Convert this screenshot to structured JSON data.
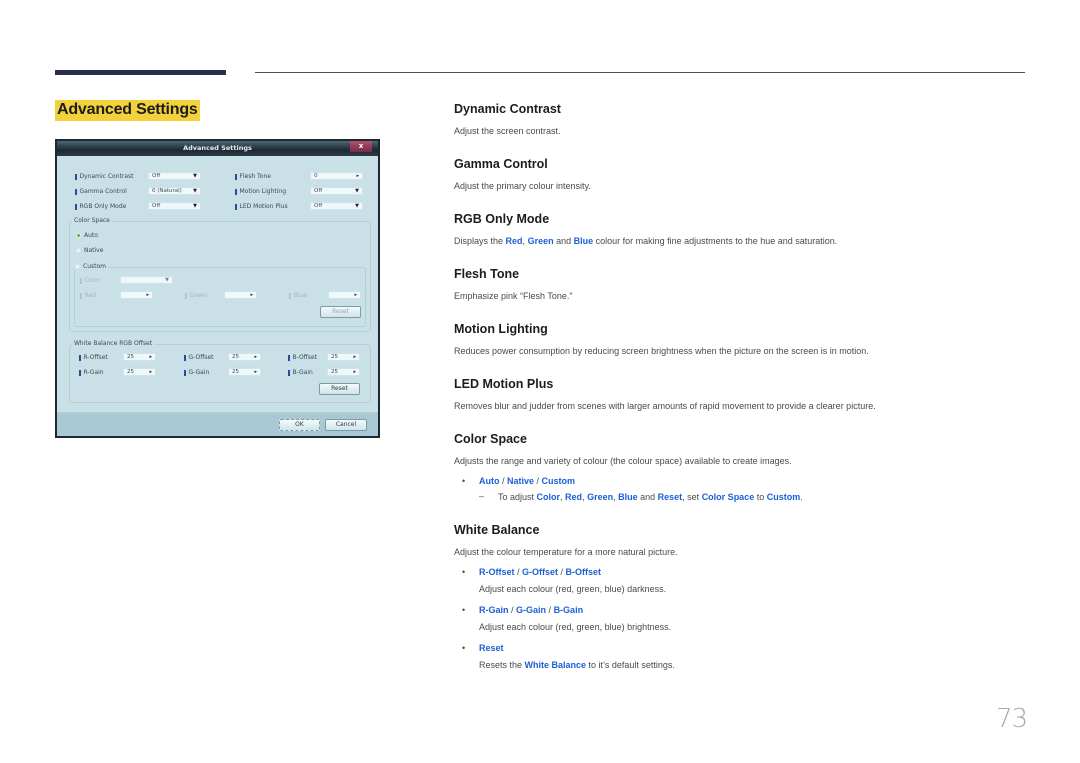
{
  "page": {
    "section_title": "Advanced Settings",
    "page_number": "73",
    "accent_color": "#1b5fd6",
    "highlight_color": "#f2d13a"
  },
  "dialog": {
    "title": "Advanced Settings",
    "close_label": "x",
    "left_settings": [
      {
        "label": "Dynamic Contrast",
        "value": "Off",
        "control": "dropdown"
      },
      {
        "label": "Gamma Control",
        "value": "0 (Natural)",
        "control": "dropdown"
      },
      {
        "label": "RGB Only Mode",
        "value": "Off",
        "control": "dropdown"
      }
    ],
    "right_settings": [
      {
        "label": "Flesh Tone",
        "value": "0",
        "control": "stepper"
      },
      {
        "label": "Motion Lighting",
        "value": "Off",
        "control": "dropdown"
      },
      {
        "label": "LED Motion Plus",
        "value": "Off",
        "control": "dropdown"
      }
    ],
    "color_space": {
      "legend": "Color Space",
      "options": [
        "Auto",
        "Native",
        "Custom"
      ],
      "selected": "Auto",
      "custom": {
        "color_label": "Color",
        "color_value": "",
        "red_label": "Red",
        "green_label": "Green",
        "blue_label": "Blue",
        "red_value": "",
        "green_value": "",
        "blue_value": "",
        "reset_label": "Reset"
      }
    },
    "white_balance": {
      "legend": "White Balance RGB Offset",
      "rows": [
        [
          {
            "label": "R-Offset",
            "value": "25"
          },
          {
            "label": "G-Offset",
            "value": "25"
          },
          {
            "label": "B-Offset",
            "value": "25"
          }
        ],
        [
          {
            "label": "R-Gain",
            "value": "25"
          },
          {
            "label": "G-Gain",
            "value": "25"
          },
          {
            "label": "B-Gain",
            "value": "25"
          }
        ]
      ],
      "reset_label": "Reset"
    },
    "ok_label": "OK",
    "cancel_label": "Cancel"
  },
  "descriptions": {
    "dynamic_contrast": {
      "title": "Dynamic Contrast",
      "text": "Adjust the screen contrast."
    },
    "gamma_control": {
      "title": "Gamma Control",
      "text": "Adjust the primary colour intensity."
    },
    "rgb_only_mode": {
      "title": "RGB Only Mode",
      "t1": "Displays the ",
      "red": "Red",
      "sep1": ", ",
      "green": "Green",
      "and": " and ",
      "blue": "Blue",
      "t2": " colour for making fine adjustments to the hue and saturation."
    },
    "flesh_tone": {
      "title": "Flesh Tone",
      "text": "Emphasize pink “Flesh Tone.”"
    },
    "motion_lighting": {
      "title": "Motion Lighting",
      "text": "Reduces power consumption by reducing screen brightness when the picture on the screen is in motion."
    },
    "led_motion_plus": {
      "title": "LED Motion Plus",
      "text": "Removes blur and judder from scenes with larger amounts of rapid movement to provide a clearer picture."
    },
    "color_space": {
      "title": "Color Space",
      "text": "Adjusts the range and variety of colour (the colour space) available to create images.",
      "bullet_symbol": "•",
      "options": [
        "Auto",
        "Native",
        "Custom"
      ],
      "slash": " / ",
      "note_dash": "–",
      "note": {
        "t1": "To adjust ",
        "color": "Color",
        "c1": ", ",
        "red": "Red",
        "c2": ", ",
        "green": "Green",
        "c3": ", ",
        "blue": "Blue",
        "and": " and ",
        "reset": "Reset",
        "t2": ", set ",
        "color_space": "Color Space",
        "to": " to ",
        "custom": "Custom",
        "end": "."
      }
    },
    "white_balance": {
      "title": "White Balance",
      "text": "Adjust the colour temperature for a more natural picture.",
      "items": [
        {
          "links": [
            "R-Offset",
            "G-Offset",
            "B-Offset"
          ],
          "desc": "Adjust each colour (red, green, blue) darkness."
        },
        {
          "links": [
            "R-Gain",
            "G-Gain",
            "B-Gain"
          ],
          "desc": "Adjust each colour (red, green, blue) brightness."
        }
      ],
      "reset": {
        "link": "Reset",
        "t1": "Resets the ",
        "wb": "White Balance",
        "t2": " to it’s default settings."
      }
    }
  }
}
